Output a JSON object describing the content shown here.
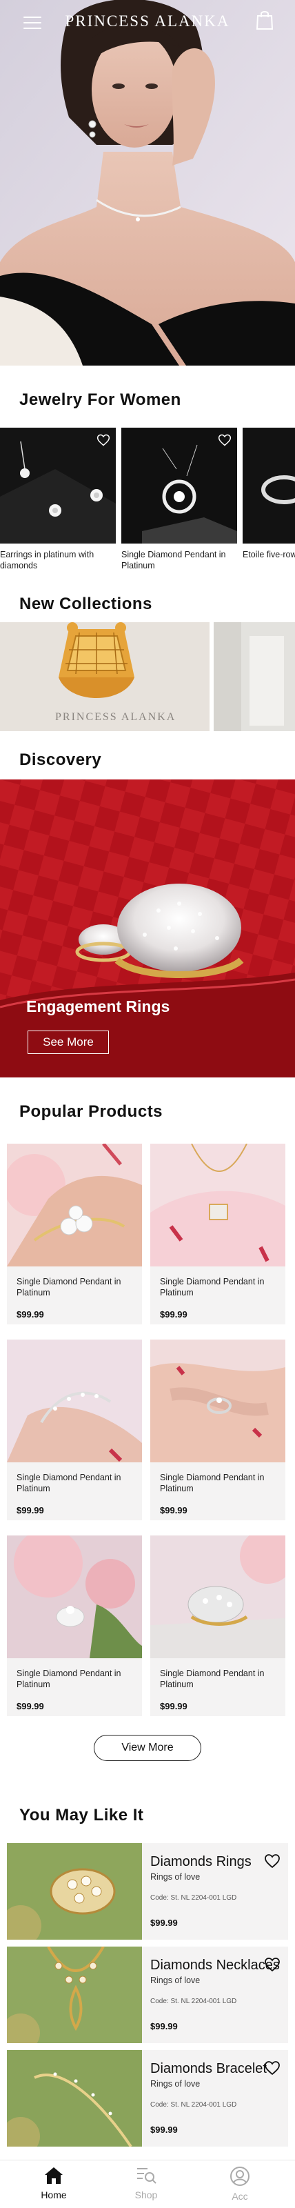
{
  "header": {
    "brand": "PRINCESS ALANKA",
    "menu_icon": "hamburger-menu-icon",
    "bag_icon": "shopping-bag-icon"
  },
  "sections": {
    "jewelry_for_women": "Jewelry For Women",
    "new_collections": "New Collections",
    "discovery": "Discovery",
    "popular_products": "Popular Products",
    "you_may_like_it": "You May Like It"
  },
  "jewelry_for_women": [
    {
      "caption": "Earrings in platinum with diamonds"
    },
    {
      "caption": "Single Diamond Pendant in Platinum"
    },
    {
      "caption": "Etoile five-row pavé diamond"
    }
  ],
  "new_collections": {
    "banner_text": "PRINCESS ALANKA"
  },
  "discovery": {
    "title": "Engagement Rings",
    "button": "See More"
  },
  "popular_products": [
    {
      "name": "Single Diamond Pendant in Platinum",
      "price": "$99.99"
    },
    {
      "name": "Single Diamond Pendant in Platinum",
      "price": "$99.99"
    },
    {
      "name": "Single Diamond Pendant in Platinum",
      "price": "$99.99"
    },
    {
      "name": "Single Diamond Pendant in Platinum",
      "price": "$99.99"
    },
    {
      "name": "Single Diamond Pendant in Platinum",
      "price": "$99.99"
    },
    {
      "name": "Single Diamond Pendant in Platinum",
      "price": "$99.99"
    }
  ],
  "view_more": "View More",
  "you_may_like": [
    {
      "title": "Diamonds Rings",
      "subtitle": "Rings of love",
      "code": "Code: St. NL 2204-001 LGD",
      "price": "$99.99"
    },
    {
      "title": "Diamonds Necklaces",
      "subtitle": "Rings of love",
      "code": "Code: St. NL 2204-001 LGD",
      "price": "$99.99"
    },
    {
      "title": "Diamonds Bracelet",
      "subtitle": "Rings of love",
      "code": "Code: St. NL 2204-001 LGD",
      "price": "$99.99"
    }
  ],
  "bottom_nav": [
    {
      "label": "Home",
      "icon": "home-icon",
      "active": true
    },
    {
      "label": "Shop",
      "icon": "shop-icon",
      "active": false
    },
    {
      "label": "Acc",
      "icon": "account-icon",
      "active": false
    }
  ],
  "colors": {
    "discovery_red": "#b3121c",
    "card_bg": "#f4f3f3",
    "nav_inactive": "#aaaaaa"
  }
}
